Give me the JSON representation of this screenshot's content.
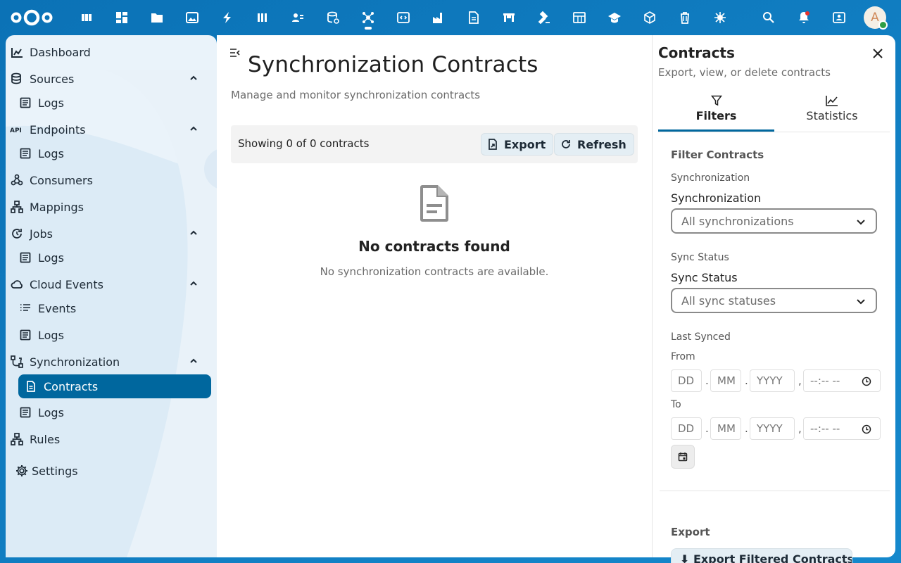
{
  "topbar": {
    "notification_color": "#e9322d",
    "avatar_initial": "A"
  },
  "sidebar": {
    "items": [
      {
        "label": "Dashboard",
        "icon": "dashboard-icon"
      },
      {
        "label": "Sources",
        "icon": "database-icon"
      },
      {
        "label": "Logs",
        "icon": "log-icon"
      },
      {
        "label": "Endpoints",
        "icon": "api-icon"
      },
      {
        "label": "Logs",
        "icon": "log-icon"
      },
      {
        "label": "Consumers",
        "icon": "webhook-icon"
      },
      {
        "label": "Mappings",
        "icon": "sitemap-icon"
      },
      {
        "label": "Jobs",
        "icon": "timer-refresh-icon"
      },
      {
        "label": "Logs",
        "icon": "log-icon"
      },
      {
        "label": "Cloud Events",
        "icon": "cloud-icon"
      },
      {
        "label": "Events",
        "icon": "message-icon"
      },
      {
        "label": "Logs",
        "icon": "log-icon"
      },
      {
        "label": "Synchronization",
        "icon": "sync-icon"
      },
      {
        "label": "Contracts",
        "icon": "file-document-icon"
      },
      {
        "label": "Logs",
        "icon": "log-icon"
      },
      {
        "label": "Rules",
        "icon": "sitemap-icon"
      },
      {
        "label": "Settings",
        "icon": "gear-icon"
      }
    ],
    "active_color": "#00679e"
  },
  "main": {
    "title": "Synchronization Contracts",
    "subtitle": "Manage and monitor synchronization contracts",
    "showing": "Showing 0 of 0 contracts",
    "export_label": "Export",
    "refresh_label": "Refresh",
    "empty_title": "No contracts found",
    "empty_desc": "No synchronization contracts are available."
  },
  "panel": {
    "title": "Contracts",
    "subtitle": "Export, view, or delete contracts",
    "tabs": [
      {
        "label": "Filters"
      },
      {
        "label": "Statistics"
      }
    ],
    "filter_heading": "Filter Contracts",
    "sync_small": "Synchronization",
    "sync_label": "Synchronization",
    "sync_value": "All synchronizations",
    "status_small": "Sync Status",
    "status_label": "Sync Status",
    "status_value": "All sync statuses",
    "last_synced": "Last Synced",
    "from_label": "From",
    "to_label": "To",
    "date_dd": "DD",
    "date_mm": "MM",
    "date_yyyy": "YYYY",
    "date_time": "--:-- --",
    "date_sep": ".",
    "date_comma": ",",
    "export_heading": "Export",
    "export_filtered": "Export Filtered Contracts"
  }
}
